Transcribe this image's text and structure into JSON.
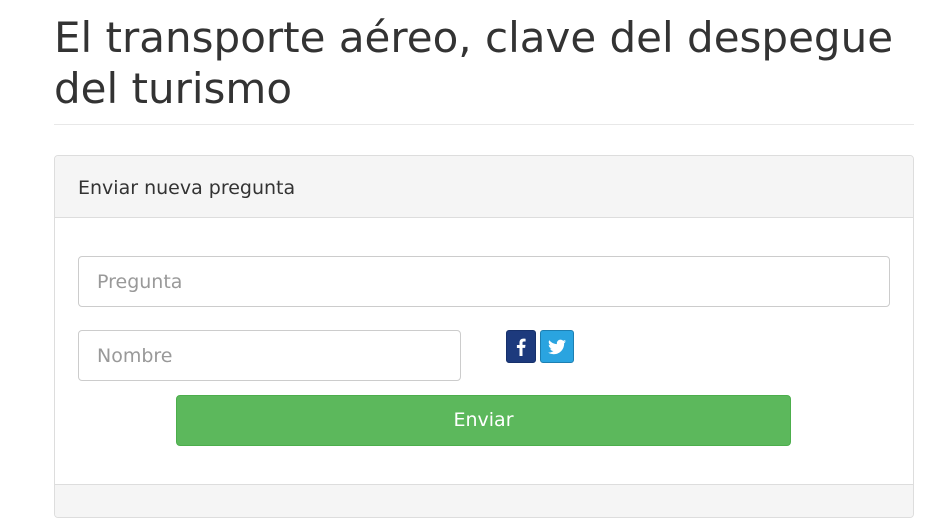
{
  "page": {
    "title": "El transporte aéreo, clave del despegue del turismo"
  },
  "panel": {
    "heading": "Enviar nueva pregunta",
    "question_placeholder": "Pregunta",
    "name_placeholder": "Nombre",
    "submit_label": "Enviar",
    "social": [
      {
        "name": "facebook",
        "icon": "facebook-icon",
        "color": "#1d3a7d"
      },
      {
        "name": "twitter",
        "icon": "twitter-icon",
        "color": "#2aa4e0"
      }
    ]
  },
  "colors": {
    "submit_button": "#5cb85c",
    "panel_heading_bg": "#f5f5f5",
    "text": "#333333"
  }
}
